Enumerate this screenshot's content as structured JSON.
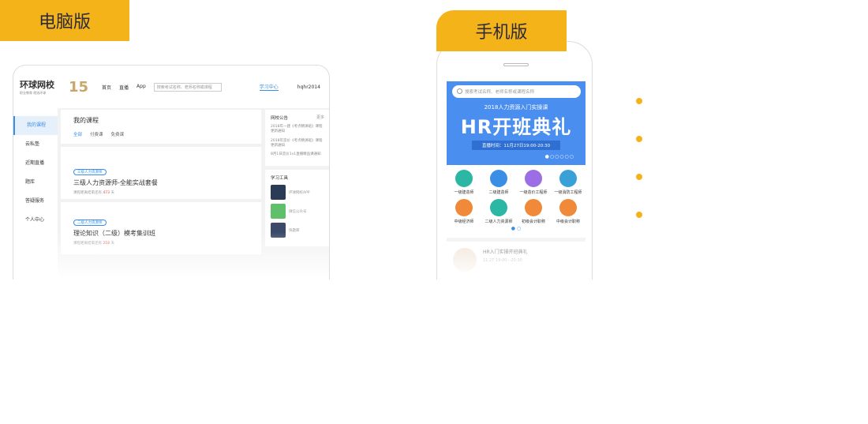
{
  "tabs": {
    "pc": "电脑版",
    "mobile": "手机版"
  },
  "pc": {
    "logo": "环球网校",
    "logo_sub": "职业教育 就选环球",
    "anniv": "15",
    "nav": [
      "首页",
      "直播",
      "App"
    ],
    "search_placeholder": "搜索考试名称、老师名称或课程",
    "learning_center": "学习中心",
    "user": "hqhr2014",
    "sidebar": [
      "我的课程",
      "云私塾",
      "近期直播",
      "题库",
      "答疑服务",
      "个人中心"
    ],
    "main_title": "我的课程",
    "filters": [
      "全部",
      "付费课",
      "免费课"
    ],
    "courses": [
      {
        "tag": "三级人力资源师",
        "title": "三级人力资源师-全能实战套餐",
        "progress_label": "课程距离结束还有",
        "days": "473",
        "unit": "天"
      },
      {
        "tag": "二级人力资源师",
        "title": "理论知识（二级）模考集训班",
        "progress_label": "课程距离结束还有",
        "days": "218",
        "unit": "天"
      }
    ],
    "notice_title": "网校公告",
    "more": "更多",
    "notices": [
      "2018年一建《考点精讲班》课程更新通知",
      "2018年造价《考点精讲班》课程更新通知",
      "8月1日造价1v1直播精品课通知"
    ],
    "tools_title": "学习工具",
    "tools": [
      {
        "label": "环球网校APP",
        "color": "#2b3a55",
        "icon": "app-icon"
      },
      {
        "label": "微信公众号",
        "color": "#5fbf6a",
        "icon": "wechat-icon"
      },
      {
        "label": "快题库",
        "color": "#3a4a68",
        "icon": "quiz-icon"
      }
    ]
  },
  "mobile": {
    "search_placeholder": "搜索考试名称、老师名称或课程名称",
    "banner_sub": "2018人力资源入门实操课",
    "banner_main": "HR开班典礼",
    "banner_time": "直播时间：11月27日19:00-20:30",
    "grid": [
      {
        "label": "一级建造师",
        "color": "#2bb7a3",
        "icon": "building-icon"
      },
      {
        "label": "二级建造师",
        "color": "#3a8ee6",
        "icon": "helmet-icon"
      },
      {
        "label": "一级造价工程师",
        "color": "#9b6ee6",
        "icon": "person-icon"
      },
      {
        "label": "一级消防工程师",
        "color": "#3aa0d8",
        "icon": "fire-extinguisher-icon"
      },
      {
        "label": "中级经济师",
        "color": "#f08a3a",
        "icon": "scale-icon"
      },
      {
        "label": "二级人力资源师",
        "color": "#2bb7a3",
        "icon": "people-icon"
      },
      {
        "label": "初级会计职称",
        "color": "#f08a3a",
        "icon": "ledger-icon"
      },
      {
        "label": "中级会计职称",
        "color": "#f08a3a",
        "icon": "chart-icon"
      }
    ],
    "live_title": "HR入门实操开班典礼",
    "live_time": "11.27 19:00－20:30"
  }
}
